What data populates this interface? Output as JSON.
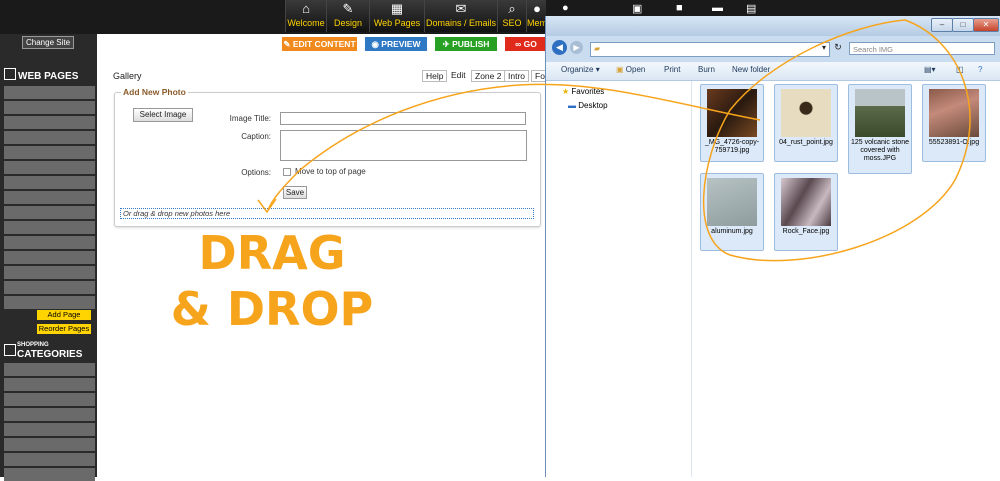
{
  "nav": {
    "welcome": "Welcome",
    "design": "Design",
    "web_pages": "Web Pages",
    "domains": "Domains / Emails",
    "seo": "SEO",
    "members": "Mem"
  },
  "sidebar": {
    "change_site": "Change Site",
    "web_pages_title": "WEB PAGES",
    "add_page": "Add Page",
    "reorder_pages": "Reorder Pages",
    "shopping_small": "SHOPPING",
    "categories_title": "CATEGORIES"
  },
  "actions": {
    "edit_content": "EDIT CONTENT",
    "preview": "PREVIEW",
    "publish": "PUBLISH",
    "go": "GO"
  },
  "content": {
    "gallery_title": "Gallery",
    "tabs": [
      "Help",
      "Edit",
      "Zone 2",
      "Intro",
      "Foo"
    ]
  },
  "form": {
    "legend": "Add New Photo",
    "select_image": "Select Image",
    "image_title_label": "Image Title:",
    "caption_label": "Caption:",
    "options_label": "Options:",
    "move_to_top": "Move to top of page",
    "save": "Save",
    "drop_hint": "Or drag & drop new photos here"
  },
  "annotation": {
    "line1": "DRAG",
    "line2": "& DROP",
    "color": "#f7a41d"
  },
  "explorer": {
    "search_placeholder": "Search IMG",
    "toolbar": {
      "organize": "Organize",
      "open": "Open",
      "print": "Print",
      "burn": "Burn",
      "new_folder": "New folder"
    },
    "nav": {
      "favorites": "Favorites",
      "desktop": "Desktop"
    },
    "files": [
      {
        "name": "_MG_4726-copy-759719.jpg",
        "icon": "image-thumbnail"
      },
      {
        "name": "04_rust_point.jpg",
        "icon": "image-thumbnail"
      },
      {
        "name": "125 volcanic stone covered with moss.JPG",
        "icon": "image-thumbnail"
      },
      {
        "name": "55523891-O.jpg",
        "icon": "image-thumbnail"
      },
      {
        "name": "aluminum.jpg",
        "icon": "image-thumbnail"
      },
      {
        "name": "Rock_Face.jpg",
        "icon": "image-thumbnail"
      }
    ]
  }
}
